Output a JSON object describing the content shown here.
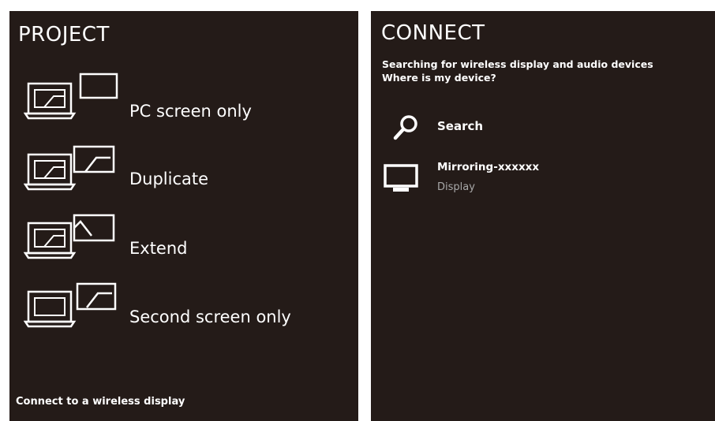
{
  "project": {
    "title": "PROJECT",
    "options": [
      {
        "label": "PC screen only",
        "icon": "pc-screen-only-icon"
      },
      {
        "label": "Duplicate",
        "icon": "duplicate-screen-icon"
      },
      {
        "label": "Extend",
        "icon": "extend-screen-icon"
      },
      {
        "label": "Second screen only",
        "icon": "second-screen-only-icon"
      }
    ],
    "footer_link": "Connect to a wireless display"
  },
  "connect": {
    "title": "CONNECT",
    "status": "Searching for wireless display and audio devices",
    "help_link": "Where is my device?",
    "search_label": "Search",
    "devices": [
      {
        "name": "Mirroring-xxxxxx",
        "type": "Display",
        "icon": "monitor-icon"
      }
    ]
  },
  "colors": {
    "panel_background": "#241b18",
    "text": "#ffffff",
    "secondary_text": "#a8a8a8",
    "page_background": "#ffffff"
  }
}
